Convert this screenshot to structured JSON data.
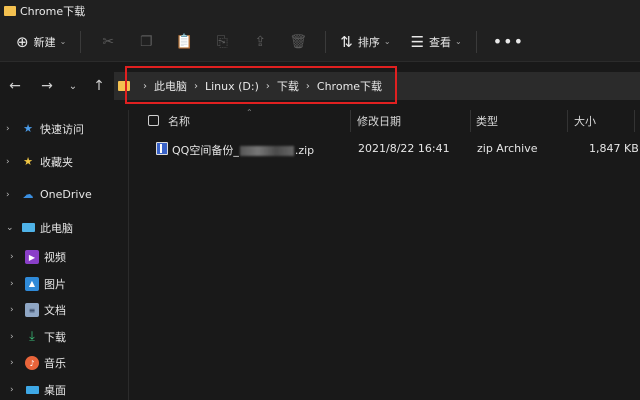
{
  "window": {
    "title": "Chrome下载"
  },
  "toolbar": {
    "new_label": "新建",
    "sort_label": "排序",
    "view_label": "查看",
    "more_label": "•••",
    "icons": [
      "cut-icon",
      "copy-icon",
      "paste-icon",
      "rename-icon",
      "share-icon",
      "delete-icon"
    ]
  },
  "address": {
    "crumbs": [
      "此电脑",
      "Linux (D:)",
      "下载",
      "Chrome下载"
    ]
  },
  "sidebar": {
    "items": [
      {
        "label": "快速访问",
        "icon": "star-icon"
      },
      {
        "label": "收藏夹",
        "icon": "star-icon"
      },
      {
        "label": "OneDrive",
        "icon": "cloud-icon"
      },
      {
        "label": "此电脑",
        "icon": "computer-icon"
      },
      {
        "label": "视频",
        "icon": "video-icon"
      },
      {
        "label": "图片",
        "icon": "picture-icon"
      },
      {
        "label": "文档",
        "icon": "document-icon"
      },
      {
        "label": "下载",
        "icon": "download-icon"
      },
      {
        "label": "音乐",
        "icon": "music-icon"
      },
      {
        "label": "桌面",
        "icon": "desktop-icon"
      }
    ]
  },
  "columns": {
    "name": "名称",
    "modified": "修改日期",
    "type": "类型",
    "size": "大小"
  },
  "files": [
    {
      "name_prefix": "QQ空间备份_",
      "name_suffix": ".zip",
      "modified": "2021/8/22 16:41",
      "type": "zip Archive",
      "size": "1,847 KB"
    }
  ],
  "colors": {
    "highlight": "#e02020",
    "folder": "#f4c150",
    "accent": "#3a63c8"
  }
}
